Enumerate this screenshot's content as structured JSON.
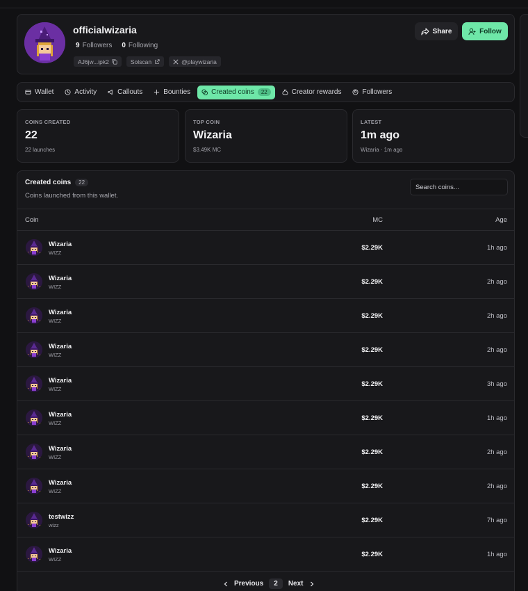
{
  "profile": {
    "username": "officialwizaria",
    "followers_count": "9",
    "followers_label": "Followers",
    "following_count": "0",
    "following_label": "Following",
    "wallet_chip": "AJ6jw...ipk2",
    "solscan_chip": "Solscan",
    "x_chip": "@playwizaria",
    "share_label": "Share",
    "follow_label": "Follow"
  },
  "tabs": [
    {
      "label": "Wallet",
      "icon": "wallet-icon"
    },
    {
      "label": "Activity",
      "icon": "clock-icon"
    },
    {
      "label": "Callouts",
      "icon": "megaphone-icon"
    },
    {
      "label": "Bounties",
      "icon": "sparkle-icon"
    },
    {
      "label": "Created coins",
      "icon": "coins-icon",
      "count": "22",
      "active": true
    },
    {
      "label": "Creator rewards",
      "icon": "money-bag-icon"
    },
    {
      "label": "Followers",
      "icon": "user-circle-icon"
    }
  ],
  "stats": [
    {
      "label": "COINS CREATED",
      "value": "22",
      "sub": "22 launches"
    },
    {
      "label": "TOP COIN",
      "value": "Wizaria",
      "sub": "$3.49K MC"
    },
    {
      "label": "LATEST",
      "value": "1m ago",
      "sub": "Wizaria · 1m ago"
    }
  ],
  "coins": {
    "title": "Created coins",
    "count": "22",
    "subtitle": "Coins launched from this wallet.",
    "search_placeholder": "Search coins...",
    "columns": {
      "coin": "Coin",
      "mc": "MC",
      "age": "Age"
    },
    "rows": [
      {
        "name": "Wizaria",
        "ticker": "WIZZ",
        "mc": "$2.29K",
        "age": "1h ago"
      },
      {
        "name": "Wizaria",
        "ticker": "WIZZ",
        "mc": "$2.29K",
        "age": "2h ago"
      },
      {
        "name": "Wizaria",
        "ticker": "WIZZ",
        "mc": "$2.29K",
        "age": "2h ago"
      },
      {
        "name": "Wizaria",
        "ticker": "WIZZ",
        "mc": "$2.29K",
        "age": "2h ago"
      },
      {
        "name": "Wizaria",
        "ticker": "WIZZ",
        "mc": "$2.29K",
        "age": "3h ago"
      },
      {
        "name": "Wizaria",
        "ticker": "WIZZ",
        "mc": "$2.29K",
        "age": "1h ago"
      },
      {
        "name": "Wizaria",
        "ticker": "WIZZ",
        "mc": "$2.29K",
        "age": "2h ago"
      },
      {
        "name": "Wizaria",
        "ticker": "WIZZ",
        "mc": "$2.29K",
        "age": "2h ago"
      },
      {
        "name": "testwizz",
        "ticker": "wizz",
        "mc": "$2.29K",
        "age": "7h ago"
      },
      {
        "name": "Wizaria",
        "ticker": "WIZZ",
        "mc": "$2.29K",
        "age": "1h ago"
      }
    ]
  },
  "pagination": {
    "prev_label": "Previous",
    "page": "2",
    "next_label": "Next"
  },
  "colors": {
    "accent": "#6ee7a8",
    "background": "#111113",
    "card": "#18181b",
    "avatar_purple": "#6b2fa3"
  }
}
